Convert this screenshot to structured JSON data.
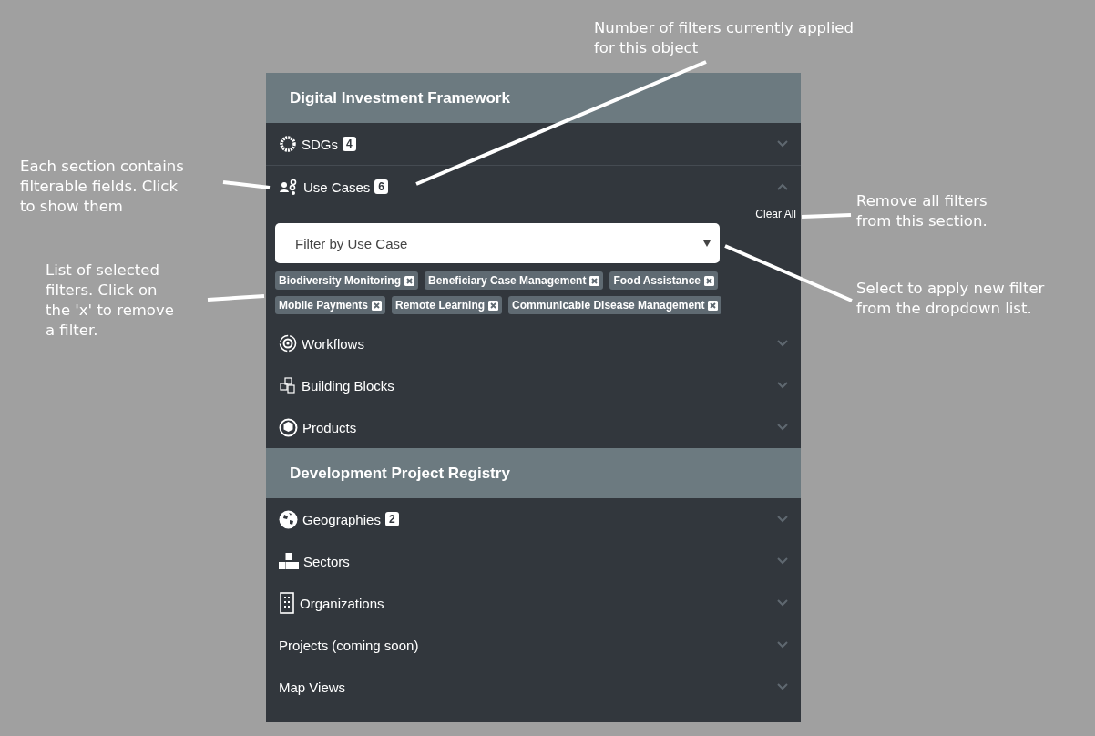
{
  "panel": {
    "groups": [
      {
        "title": "Digital Investment Framework",
        "sections": [
          {
            "label": "SDGs",
            "count": "4",
            "expanded": false
          },
          {
            "label": "Use Cases",
            "count": "6",
            "expanded": true,
            "clear_all": "Clear All",
            "dropdown": {
              "placeholder": "Filter by Use Case"
            },
            "tags": [
              "Biodiversity Monitoring",
              "Beneficiary Case Management",
              "Food Assistance",
              "Mobile Payments",
              "Remote Learning",
              "Communicable Disease Management"
            ]
          },
          {
            "label": "Workflows",
            "expanded": false
          },
          {
            "label": "Building Blocks",
            "expanded": false
          },
          {
            "label": "Products",
            "expanded": false
          }
        ]
      },
      {
        "title": "Development Project Registry",
        "sections": [
          {
            "label": "Geographies",
            "count": "2",
            "expanded": false
          },
          {
            "label": "Sectors",
            "expanded": false
          },
          {
            "label": "Organizations",
            "expanded": false
          },
          {
            "label": "Projects (coming soon)",
            "expanded": false
          },
          {
            "label": "Map Views",
            "expanded": false
          }
        ]
      }
    ]
  },
  "annotations": [
    {
      "text": "Number of filters currently applied\nfor this object"
    },
    {
      "text": "Each section contains\nfilterable fields. Click\nto show them"
    },
    {
      "text": "Remove all filters\nfrom this section."
    },
    {
      "text": "List of selected\nfilters. Click on\nthe 'x' to remove\na filter."
    },
    {
      "text": "Select to apply new filter\nfrom the dropdown list."
    }
  ]
}
